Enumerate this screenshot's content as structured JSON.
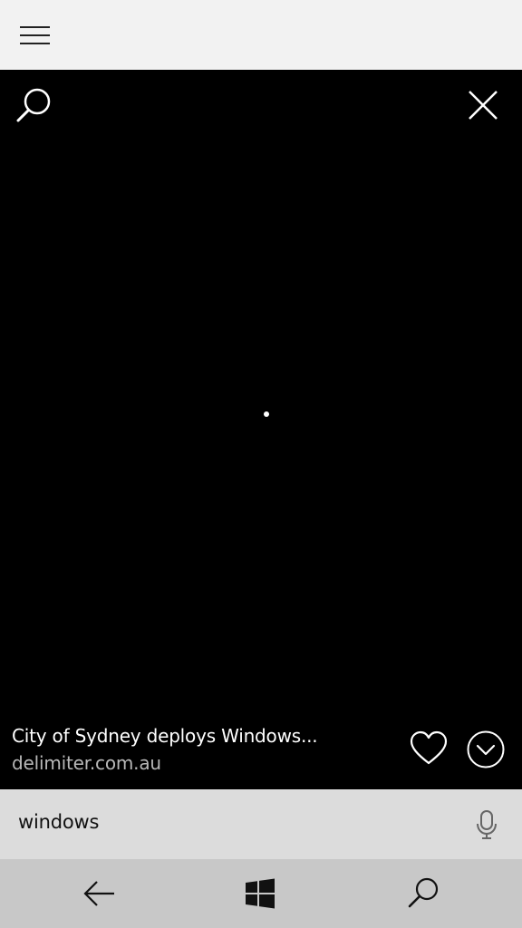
{
  "top_bar": {
    "menu_icon": "hamburger-menu-icon"
  },
  "viewer": {
    "search_icon": "search-icon",
    "close_icon": "close-icon",
    "loading_indicator": "loading-dot",
    "caption": {
      "title": "City of Sydney deploys Windows...",
      "source": "delimiter.com.au"
    },
    "favorite_icon": "heart-icon",
    "expand_icon": "chevron-down-circle-icon"
  },
  "search_bar": {
    "value": "windows",
    "mic_icon": "microphone-icon"
  },
  "nav_bar": {
    "back_icon": "back-arrow-icon",
    "start_icon": "windows-logo-icon",
    "search_icon": "search-icon"
  },
  "colors": {
    "viewer_background": "#000000",
    "top_bar_background": "#f2f2f2",
    "search_bar_background": "#dcdcdc",
    "nav_bar_background": "#c8c8c8",
    "caption_title": "#ffffff",
    "caption_source": "#b8b8b8"
  }
}
